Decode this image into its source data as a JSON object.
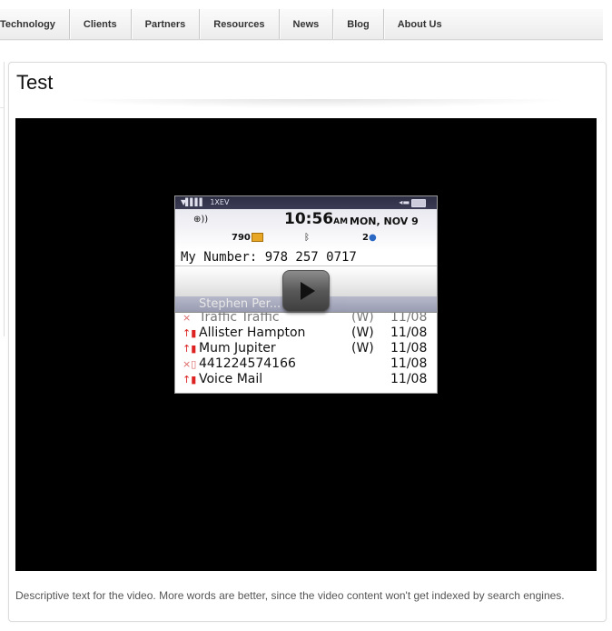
{
  "nav": {
    "items": [
      {
        "label": "Technology"
      },
      {
        "label": "Clients"
      },
      {
        "label": "Partners"
      },
      {
        "label": "Resources"
      },
      {
        "label": "News"
      },
      {
        "label": "Blog"
      },
      {
        "label": "About Us"
      }
    ]
  },
  "main": {
    "title": "Test",
    "description": "Descriptive text for the video. More words are better, since the video content won't get indexed by search engines."
  },
  "video": {
    "thumbnail": {
      "network": "1XEV",
      "time": "10:56",
      "ampm": "AM",
      "date": "MON, NOV 9",
      "messages": "790",
      "pin_count": "2",
      "my_number": "My Number: 978 257 0717",
      "partial_row": "Traffic Traffic",
      "partial_tag": "(W)",
      "partial_date": "11/08",
      "ghost_row": "Stephen Per...",
      "calls": [
        {
          "name": "Allister Hampton",
          "tag": "(W)",
          "date": "11/08",
          "icon": "outgoing-call-icon"
        },
        {
          "name": "Mum Jupiter",
          "tag": "(W)",
          "date": "11/08",
          "icon": "outgoing-call-icon"
        },
        {
          "name": "441224574166",
          "tag": "",
          "date": "11/08",
          "icon": "missed-call-icon"
        },
        {
          "name": "Voice Mail",
          "tag": "",
          "date": "11/08",
          "icon": "outgoing-call-icon"
        }
      ]
    },
    "colors": {
      "background": "#000000",
      "statusbar": "#2e2e44",
      "envelope": "#e7a623"
    }
  }
}
